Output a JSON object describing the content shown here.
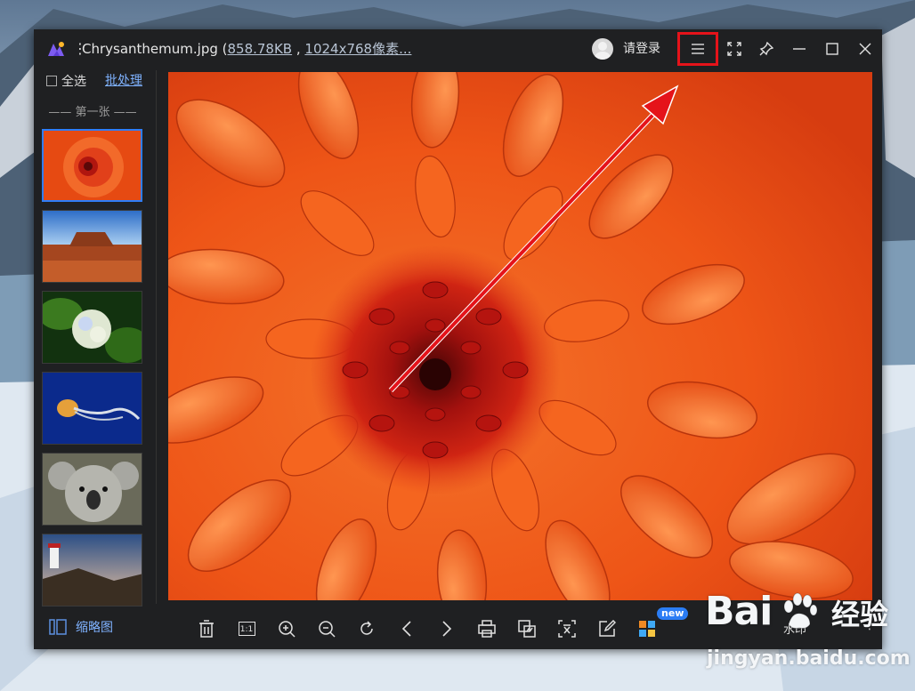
{
  "window": {
    "title_prefix": "Chrysanthemum.jpg (",
    "file_size": "858.78KB",
    "separator": " , ",
    "dimensions": "1024x768像素...",
    "login_label": "请登录"
  },
  "sidebar": {
    "select_all_label": "全选",
    "batch_label": "批处理",
    "first_label": "—— 第一张 ——",
    "thumbnails": [
      {
        "subject": "chrysanthemum",
        "selected": true
      },
      {
        "subject": "desert"
      },
      {
        "subject": "hydrangeas"
      },
      {
        "subject": "jellyfish"
      },
      {
        "subject": "koala"
      },
      {
        "subject": "lighthouse"
      }
    ]
  },
  "toolbar": {
    "thumbnail_toggle_label": "缩略图",
    "new_badge": "new",
    "one_to_one_label": "1:1",
    "watermark_button_label": "水印",
    "icons": [
      "delete-icon",
      "actual-size-icon",
      "zoom-in-icon",
      "zoom-out-icon",
      "rotate-icon",
      "previous-icon",
      "next-icon",
      "print-icon",
      "convert-icon",
      "ocr-text-icon",
      "edit-icon",
      "apps-icon"
    ]
  },
  "watermark": {
    "brand": "Bai",
    "product": "经验",
    "site": "jingyan.baidu.com"
  },
  "colors": {
    "accent": "#2f7df6",
    "highlight": "#e5131a",
    "link": "#7fb2ff"
  }
}
